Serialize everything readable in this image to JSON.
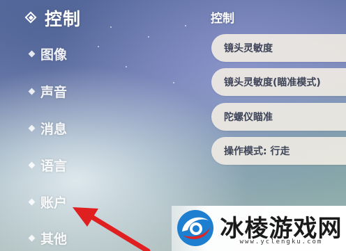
{
  "sidebar": {
    "title": "控制",
    "items": [
      {
        "label": "图像"
      },
      {
        "label": "声音"
      },
      {
        "label": "消息"
      },
      {
        "label": "语言"
      },
      {
        "label": "账户"
      },
      {
        "label": "其他"
      }
    ]
  },
  "main": {
    "section_title": "控制",
    "settings": [
      {
        "label": "镜头灵敏度"
      },
      {
        "label": "镜头灵敏度(瞄准模式)"
      },
      {
        "label": "陀螺仪瞄准"
      },
      {
        "label": "操作模式: 行走"
      }
    ]
  },
  "annotation": {
    "color": "#e02020"
  },
  "watermark": {
    "name": "冰棱游戏网",
    "url": "www.yclengku.com",
    "logo_colors": {
      "blue": "#1e7fd0",
      "red": "#e02424"
    }
  },
  "icons": {
    "header": "diamond-outline-icon",
    "bullet": "diamond-bullet-icon",
    "logo": "swirl-logo-icon"
  }
}
